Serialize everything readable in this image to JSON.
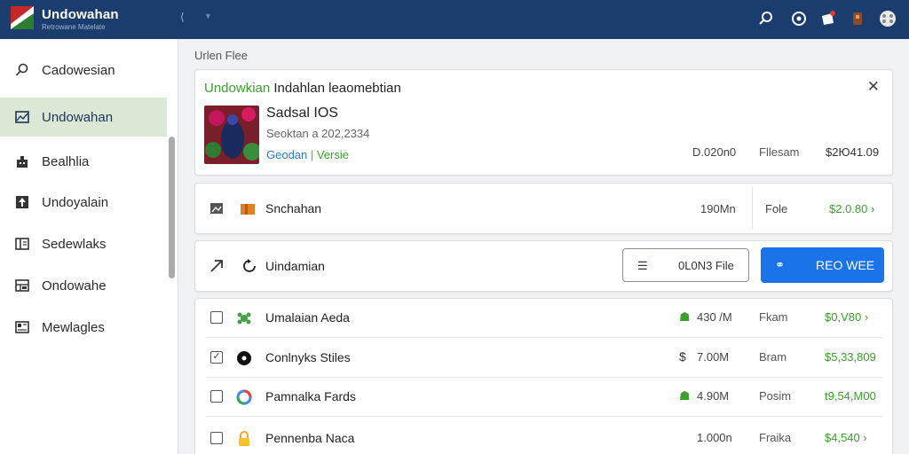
{
  "app": {
    "title": "Undowahan",
    "subtitle": "Retrowane Matelate"
  },
  "topbar": {
    "back_icon": "back-arrow-icon",
    "dropdown_icon": "chevron-down-icon",
    "icons": [
      "search-icon",
      "settings-circle-icon",
      "notification-icon",
      "extension-icon",
      "apps-icon"
    ]
  },
  "sidebar": {
    "items": [
      {
        "label": "Cadowesian",
        "icon": "search-icon",
        "active": false
      },
      {
        "label": "Undowahan",
        "icon": "image-icon",
        "active": true
      },
      {
        "label": "Bealhlia",
        "icon": "building-icon",
        "active": false
      },
      {
        "label": "Undoyalain",
        "icon": "upload-icon",
        "active": false
      },
      {
        "label": "Sedewlaks",
        "icon": "book-icon",
        "active": false
      },
      {
        "label": "Ondowahe",
        "icon": "grid-icon",
        "active": false
      },
      {
        "label": "Mewlagles",
        "icon": "layout-icon",
        "active": false
      }
    ]
  },
  "main": {
    "section_title": "Urlen Flee",
    "featured": {
      "title_green": "Undowkian",
      "title_rest": " Indahlan leaomebtian",
      "name": "Sadsal IOS",
      "sub": "Seoktan a 202,2334",
      "link_left": "Geodan",
      "link_sep": " | ",
      "link_right": "Versie",
      "value_1": "D.020n0",
      "value_2": "Fllesam",
      "value_3": "$2Ю41.09"
    },
    "row1": {
      "label": "Snchahan",
      "size": "190Mn",
      "file_label": "Fole",
      "price": "$2.0.80 ›"
    },
    "row2": {
      "label": "Uindamian",
      "button_outline": "0L0N3 File",
      "button_primary": "REO WEE"
    },
    "files": [
      {
        "name": "Umalaian Aeda",
        "mark": "☗",
        "mark_color": "#3aa12b",
        "size": "430 /M",
        "unit": "Fkam",
        "price": "$0,V80 ›",
        "checked": false,
        "icon": "leaf-icon"
      },
      {
        "name": "Conlnyks Stiles",
        "mark": "$",
        "mark_color": "#333333",
        "size": "7.00M",
        "unit": "Bram",
        "price": "$5,33,809",
        "checked": true,
        "icon": "target-icon"
      },
      {
        "name": "Pamnalka Fards",
        "mark": "☗",
        "mark_color": "#3aa12b",
        "size": "4.90M",
        "unit": "Posim",
        "price": "t9,54,M00",
        "checked": false,
        "icon": "google-icon"
      },
      {
        "name": "Pennenba Naca",
        "mark": "",
        "mark_color": "#333333",
        "size": "1.000n",
        "unit": "Fraika",
        "price": "$4,540 ›",
        "checked": false,
        "icon": "lock-icon"
      }
    ]
  },
  "colors": {
    "topbar": "#1b3d6e",
    "accent_green": "#3aa12b",
    "primary_blue": "#1a73e8",
    "active_bg": "#dbe8d5"
  }
}
